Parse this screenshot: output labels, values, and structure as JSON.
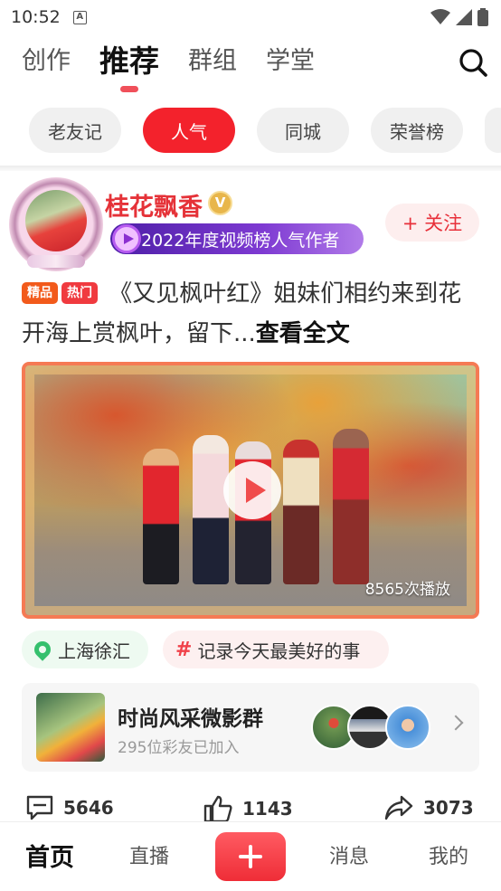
{
  "status_bar": {
    "time": "10:52"
  },
  "top_tabs": [
    {
      "label": "创作",
      "active": false
    },
    {
      "label": "推荐",
      "active": true
    },
    {
      "label": "群组",
      "active": false
    },
    {
      "label": "学堂",
      "active": false
    }
  ],
  "chips": [
    {
      "label": "老友记",
      "active": false
    },
    {
      "label": "人气",
      "active": true
    },
    {
      "label": "同城",
      "active": false
    },
    {
      "label": "荣誉榜",
      "active": false
    }
  ],
  "post": {
    "author": "桂花飘香",
    "award": "2022年度视频榜人气作者",
    "follow_label": "+ 关注",
    "tags": [
      "精品",
      "热门"
    ],
    "caption": "《又见枫叶红》姐妹们相约来到花开海上赏枫叶，留下...",
    "read_more": "查看全文",
    "play_count": "8565次播放",
    "location": "上海徐汇",
    "topic": "记录今天最美好的事"
  },
  "group": {
    "name": "时尚风采微影群",
    "members": "295位彩友已加入"
  },
  "stats": {
    "comments": "5646",
    "likes": "1143",
    "shares": "3073"
  },
  "bottom_nav": [
    {
      "label": "首页",
      "active": true
    },
    {
      "label": "直播",
      "active": false
    },
    {
      "label": "消息",
      "active": false
    },
    {
      "label": "我的",
      "active": false
    }
  ],
  "colors": {
    "accent": "#f3222c",
    "author": "#e53238",
    "award_bg": "#6a2dc4"
  }
}
